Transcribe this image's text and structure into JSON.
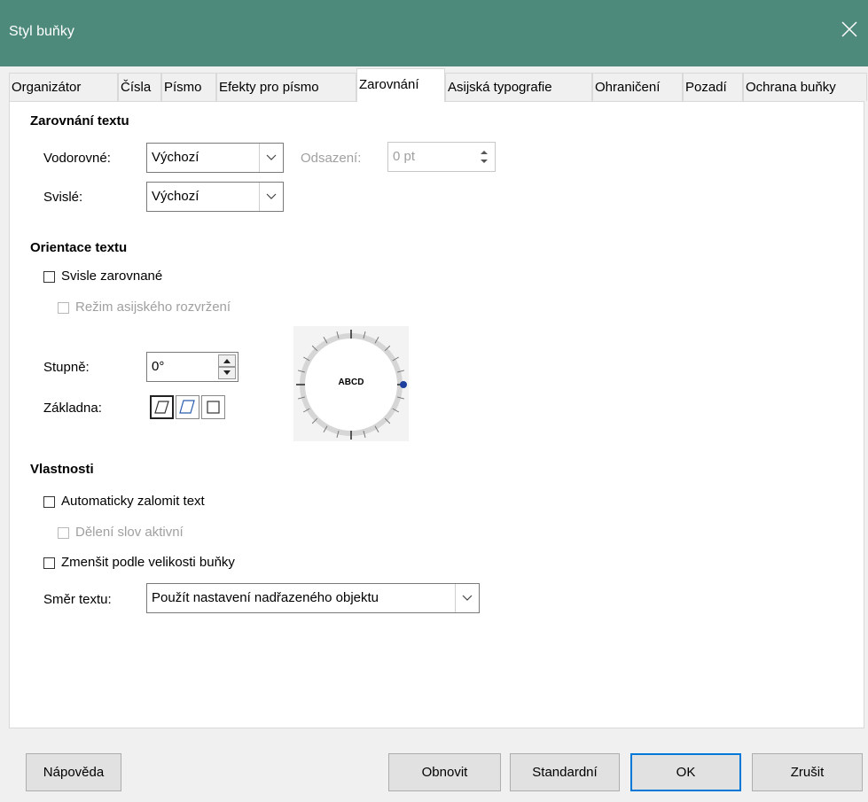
{
  "window": {
    "title": "Styl buňky"
  },
  "tabs": [
    {
      "label": "Organizátor"
    },
    {
      "label": "Čísla"
    },
    {
      "label": "Písmo"
    },
    {
      "label": "Efekty pro písmo"
    },
    {
      "label": "Zarovnání"
    },
    {
      "label": "Asijská typografie"
    },
    {
      "label": "Ohraničení"
    },
    {
      "label": "Pozadí"
    },
    {
      "label": "Ochrana buňky"
    }
  ],
  "active_tab": "Zarovnání",
  "text_alignment": {
    "heading": "Zarovnání textu",
    "horizontal_label": "Vodorovné:",
    "horizontal_value": "Výchozí",
    "indent_label": "Odsazení:",
    "indent_value": "0 pt",
    "vertical_label": "Svislé:",
    "vertical_value": "Výchozí"
  },
  "text_orientation": {
    "heading": "Orientace textu",
    "vertical_stacked_label": "Svisle zarovnané",
    "asian_layout_label": "Režim asijského rozvržení",
    "degrees_label": "Stupně:",
    "degrees_value": "0°",
    "reference_label": "Základna:",
    "dial_text": "ABCD"
  },
  "properties": {
    "heading": "Vlastnosti",
    "wrap_label": "Automaticky zalomit text",
    "hyphenation_label": "Dělení slov aktivní",
    "shrink_label": "Zmenšit podle velikosti buňky",
    "direction_label": "Směr textu:",
    "direction_value": "Použít nastavení nadřazeného objektu"
  },
  "buttons": {
    "help": "Nápověda",
    "reset": "Obnovit",
    "standard": "Standardní",
    "ok": "OK",
    "cancel": "Zrušit"
  },
  "colors": {
    "titlebar": "#4e8a7b",
    "ok_border": "#0078d7",
    "dial_handle": "#1f3f9f"
  }
}
